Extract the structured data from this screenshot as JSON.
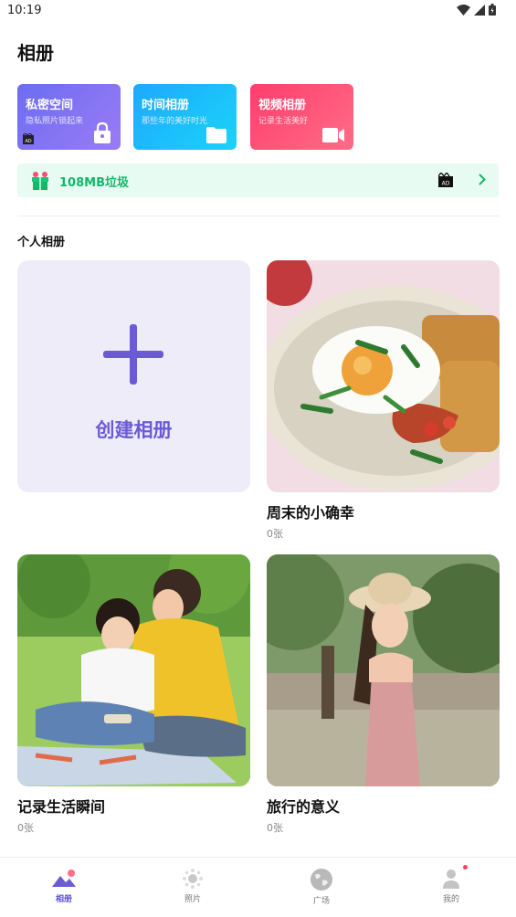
{
  "status_bar": {
    "time": "10:19"
  },
  "page": {
    "title": "相册"
  },
  "feature_cards": [
    {
      "title": "私密空间",
      "subtitle": "隐私照片锁起来",
      "icon": "lock-icon",
      "color": "#7b6ff3"
    },
    {
      "title": "时间相册",
      "subtitle": "那些年的美好时光",
      "icon": "folder-icon",
      "color": "#1fbcfa"
    },
    {
      "title": "视频相册",
      "subtitle": "记录生活美好",
      "icon": "video-camera-icon",
      "color": "#ff4b74"
    }
  ],
  "ad_badge": "AD",
  "trash": {
    "label": "108MB垃圾",
    "color": "#12b76a"
  },
  "section": {
    "title": "个人相册"
  },
  "create_album": {
    "label": "创建相册",
    "accent": "#6a5ad6"
  },
  "albums": [
    {
      "name": "周末的小确幸",
      "count": "0张"
    },
    {
      "name": "记录生活瞬间",
      "count": "0张"
    },
    {
      "name": "旅行的意义",
      "count": "0张"
    }
  ],
  "nav": [
    {
      "label": "相册",
      "icon": "album-icon",
      "active": true
    },
    {
      "label": "照片",
      "icon": "photo-icon",
      "active": false
    },
    {
      "label": "广场",
      "icon": "globe-icon",
      "active": false
    },
    {
      "label": "我的",
      "icon": "profile-icon",
      "active": false
    }
  ]
}
